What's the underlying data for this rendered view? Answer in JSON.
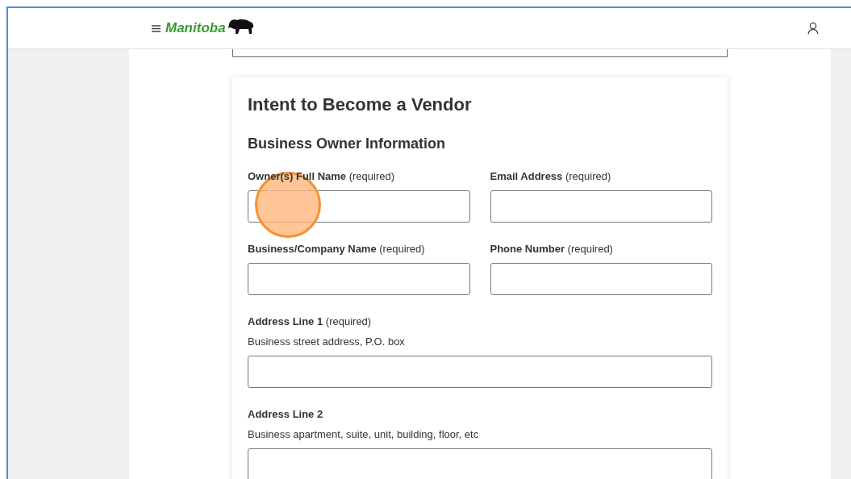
{
  "header": {
    "brand": "Manitoba"
  },
  "form": {
    "title": "Intent to Become a Vendor",
    "section": "Business Owner Information",
    "fields": [
      {
        "kind": "half",
        "label": "**Owner(s) Full Name** (required)",
        "clicked": true
      },
      {
        "kind": "half",
        "label": "**Email Address** (required)",
        "clicked": false
      },
      {
        "kind": "half",
        "label": "**Business/Company Name** (required)",
        "clicked": false
      },
      {
        "kind": "half",
        "label": "**Phone Number** (required)",
        "clicked": false
      },
      {
        "kind": "full",
        "label": "**Address Line 1** (required)",
        "hint": "Business street address, P.O. box",
        "clicked": false
      },
      {
        "kind": "full",
        "label": "**Address Line 2**",
        "hint": "Business apartment, suite, unit, building, floor, etc",
        "clicked": false
      }
    ]
  }
}
